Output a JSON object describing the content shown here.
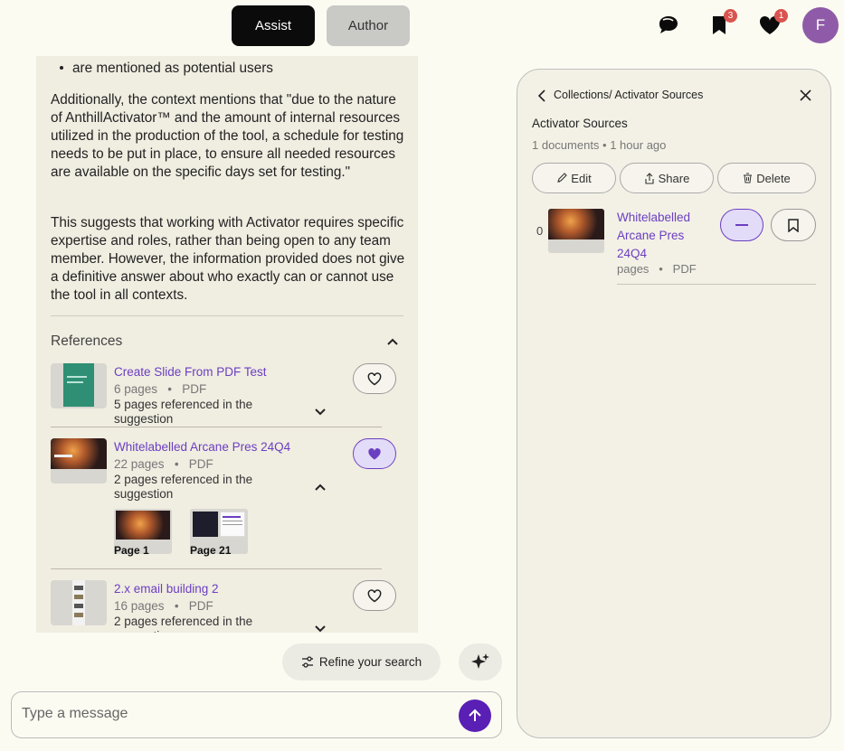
{
  "header": {
    "modes": [
      "Assist",
      "Author"
    ],
    "active_mode": "Assist",
    "bookmark_count": "3",
    "favorites_count": "1",
    "avatar_initial": "F"
  },
  "chat": {
    "partial_line": "are mentioned as potential users",
    "paragraph_1": "Additionally, the context mentions that \"due to the nature of AnthillActivator™ and the amount of internal resources utilized in the production of the tool, a schedule for testing needs to be put in place, to ensure all needed resources are available on the specific days set for testing.\"",
    "paragraph_2": "This suggests that working with Activator requires specific expertise and roles, rather than being open to any team member. However, the information provided does not give a definitive answer about who exactly can or cannot use the tool in all contexts.",
    "references_title": "References",
    "references": [
      {
        "title": "Create Slide From PDF Test",
        "pages": "6 pages",
        "type": "PDF",
        "desc": "5 pages referenced in the suggestion",
        "favorited": false,
        "expanded": false
      },
      {
        "title": "Whitelabelled Arcane Pres 24Q4",
        "pages": "22 pages",
        "type": "PDF",
        "desc": "2 pages referenced in the suggestion",
        "favorited": true,
        "expanded": true,
        "page_refs": [
          {
            "label": "Page 1"
          },
          {
            "label": "Page 21"
          }
        ]
      },
      {
        "title": "2.x email building 2",
        "pages": "16 pages",
        "type": "PDF",
        "desc": "2 pages referenced in the suggestion",
        "favorited": false,
        "expanded": false
      }
    ]
  },
  "composer": {
    "refine_label": "Refine your search",
    "placeholder": "Type a message"
  },
  "collection": {
    "breadcrumb": "Collections/ Activator Sources",
    "title": "Activator Sources",
    "meta_count": "1 documents",
    "meta_time": "1 hour ago",
    "actions": [
      "Edit",
      "Share",
      "Delete"
    ],
    "documents": [
      {
        "index": "0",
        "title": "Whitelabelled Arcane Pres 24Q4",
        "pages": "pages",
        "type": "PDF"
      }
    ]
  },
  "colors": {
    "accent": "#6b3fc1",
    "send": "#5a1fb5",
    "avatar": "#8f5ba8",
    "badge": "#d9534f"
  }
}
